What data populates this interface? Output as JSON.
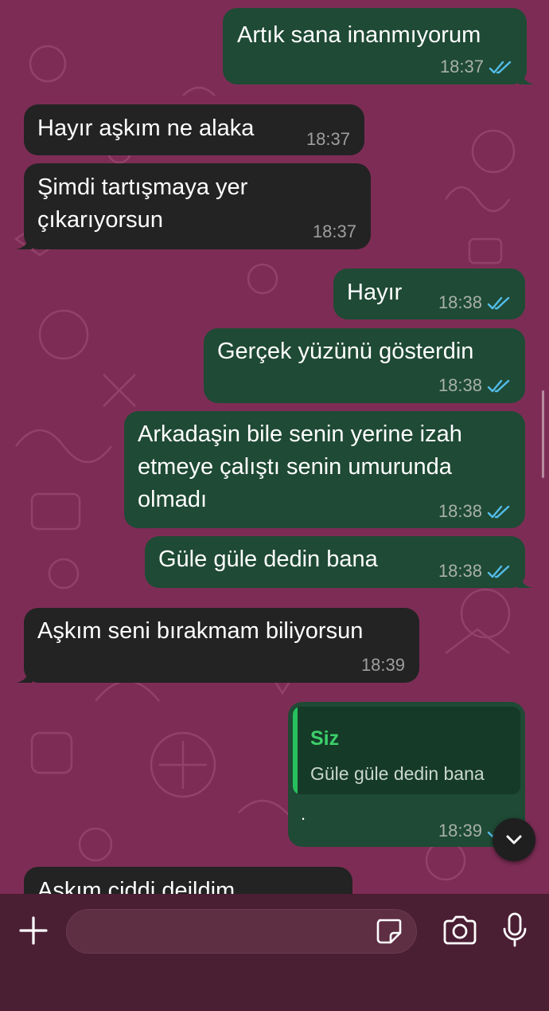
{
  "colors": {
    "wallpaper": "#7d2d55",
    "incoming_bubble": "#232323",
    "outgoing_bubble": "#1f4a35",
    "read_ticks": "#53bdeb",
    "quote_accent": "#27c05e"
  },
  "messages": [
    {
      "text": "Artık sana inanmıyorum",
      "time": "18:37"
    },
    {
      "text": "Hayır aşkım ne alaka",
      "time": "18:37"
    },
    {
      "line1": "Şimdi tartışmaya yer",
      "line2": "çıkarıyorsun",
      "time": "18:37"
    },
    {
      "text": "Hayır",
      "time": "18:38"
    },
    {
      "text": "Gerçek yüzünü gösterdin",
      "time": "18:38"
    },
    {
      "line1": "Arkadaşin bile senin yerine izah",
      "line2": "etmeye çalıştı senin umurunda",
      "line3": "olmadı",
      "time": "18:38"
    },
    {
      "text": "Güle güle dedin bana",
      "time": "18:38"
    },
    {
      "text": "Aşkım seni bırakmam biliyorsun",
      "time": "18:39"
    },
    {
      "quote_author": "Siz",
      "quote_text": "Güle güle dedin bana",
      "text": ".",
      "time": "18:39"
    },
    {
      "text": "Aşkım ciddi deildim"
    }
  ],
  "composer": {
    "add_icon": "plus-icon",
    "sticker_icon": "sticker-icon",
    "camera_icon": "camera-icon",
    "mic_icon": "microphone-icon",
    "input_value": ""
  },
  "scroll_button_icon": "chevron-down-icon"
}
